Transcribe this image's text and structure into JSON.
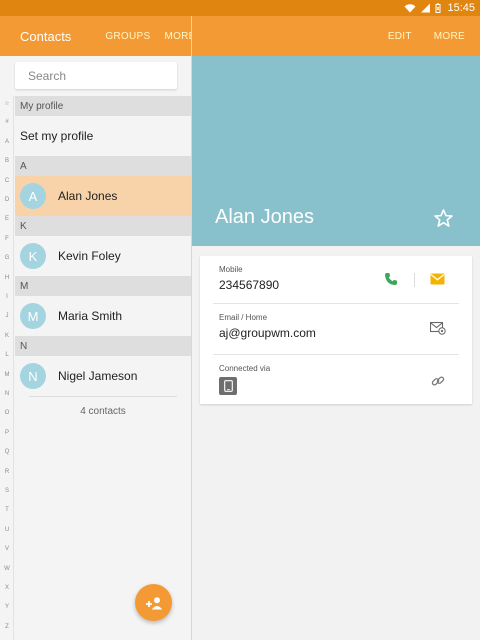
{
  "status_bar": {
    "time": "15:45"
  },
  "left_bar": {
    "title": "Contacts",
    "groups_label": "GROUPS",
    "more_label": "MORE"
  },
  "right_bar": {
    "edit_label": "EDIT",
    "more_label": "MORE"
  },
  "search": {
    "placeholder": "Search"
  },
  "alpha_index": [
    "☆",
    "#",
    "A",
    "B",
    "C",
    "D",
    "E",
    "F",
    "G",
    "H",
    "I",
    "J",
    "K",
    "L",
    "M",
    "N",
    "O",
    "P",
    "Q",
    "R",
    "S",
    "T",
    "U",
    "V",
    "W",
    "X",
    "Y",
    "Z"
  ],
  "contacts_list": {
    "my_profile_header": "My profile",
    "set_profile": "Set my profile",
    "sections": [
      {
        "letter": "A",
        "name": "Alan Jones",
        "initial": "A"
      },
      {
        "letter": "K",
        "name": "Kevin Foley",
        "initial": "K"
      },
      {
        "letter": "M",
        "name": "Maria Smith",
        "initial": "M"
      },
      {
        "letter": "N",
        "name": "Nigel Jameson",
        "initial": "N"
      }
    ],
    "count_text": "4 contacts"
  },
  "detail": {
    "name": "Alan Jones",
    "mobile_label": "Mobile",
    "mobile_value": "234567890",
    "email_label": "Email / Home",
    "email_value": "aj@groupwm.com",
    "connected_label": "Connected via"
  },
  "colors": {
    "status_bar": "#e0850f",
    "app_bar": "#f49a35",
    "hero": "#88c0cc",
    "selected_row": "#f8d3aa",
    "avatar": "#a3d4e0",
    "call_icon": "#3aa85a",
    "message_icon": "#f5b300"
  }
}
